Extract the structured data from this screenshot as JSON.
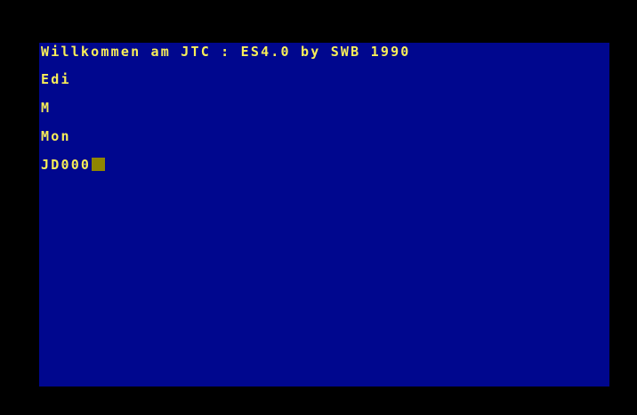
{
  "terminal": {
    "lines": [
      "Willkommen am JTC : ES4.0 by SWB 1990",
      "Edi",
      "M",
      "Mon",
      "JD000"
    ]
  },
  "colors": {
    "border": "#000000",
    "screen_background": "#00078e",
    "text": "#f7ee58",
    "cursor": "#8f8500"
  }
}
